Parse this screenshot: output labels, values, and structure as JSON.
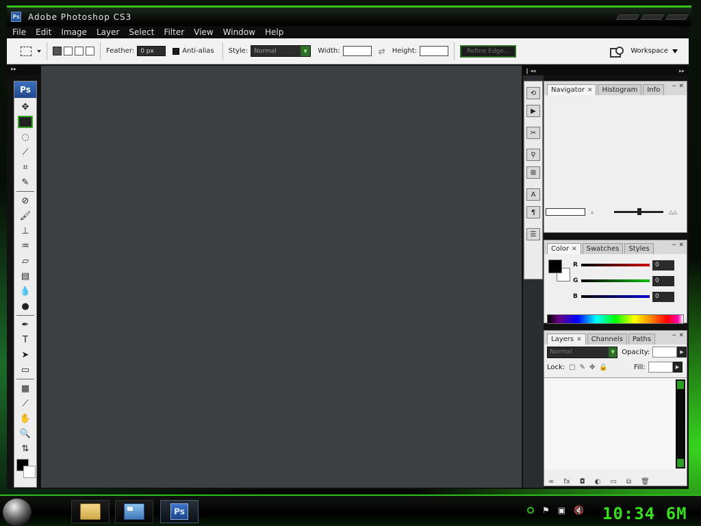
{
  "window": {
    "title": "Adobe Photoshop CS3",
    "app_badge": "Ps"
  },
  "menu": [
    "File",
    "Edit",
    "Image",
    "Layer",
    "Select",
    "Filter",
    "View",
    "Window",
    "Help"
  ],
  "options": {
    "feather_label": "Feather:",
    "feather_value": "0 px",
    "antialias_label": "Anti-alias",
    "style_label": "Style:",
    "style_value": "Normal",
    "width_label": "Width:",
    "height_label": "Height:",
    "refine_edge": "Refine Edge...",
    "workspace": "Workspace"
  },
  "toolbox": {
    "logo": "Ps"
  },
  "panels": {
    "navigator_tabs": [
      "Navigator",
      "Histogram",
      "Info"
    ],
    "color_tabs": [
      "Color",
      "Swatches",
      "Styles"
    ],
    "layers_tabs": [
      "Layers",
      "Channels",
      "Paths"
    ]
  },
  "color": {
    "r_label": "R",
    "g_label": "G",
    "b_label": "B",
    "r_value": "0",
    "g_value": "0",
    "b_value": "0",
    "r_bar": "#cc0000",
    "g_bar": "#00b000",
    "b_bar": "#0000cc"
  },
  "layers": {
    "blend_mode": "Normal",
    "opacity_label": "Opacity:",
    "lock_label": "Lock:",
    "fill_label": "Fill:"
  },
  "taskbar": {
    "clock": "10:34 6M",
    "ps_label": "Ps",
    "accent": "#37e01c"
  }
}
